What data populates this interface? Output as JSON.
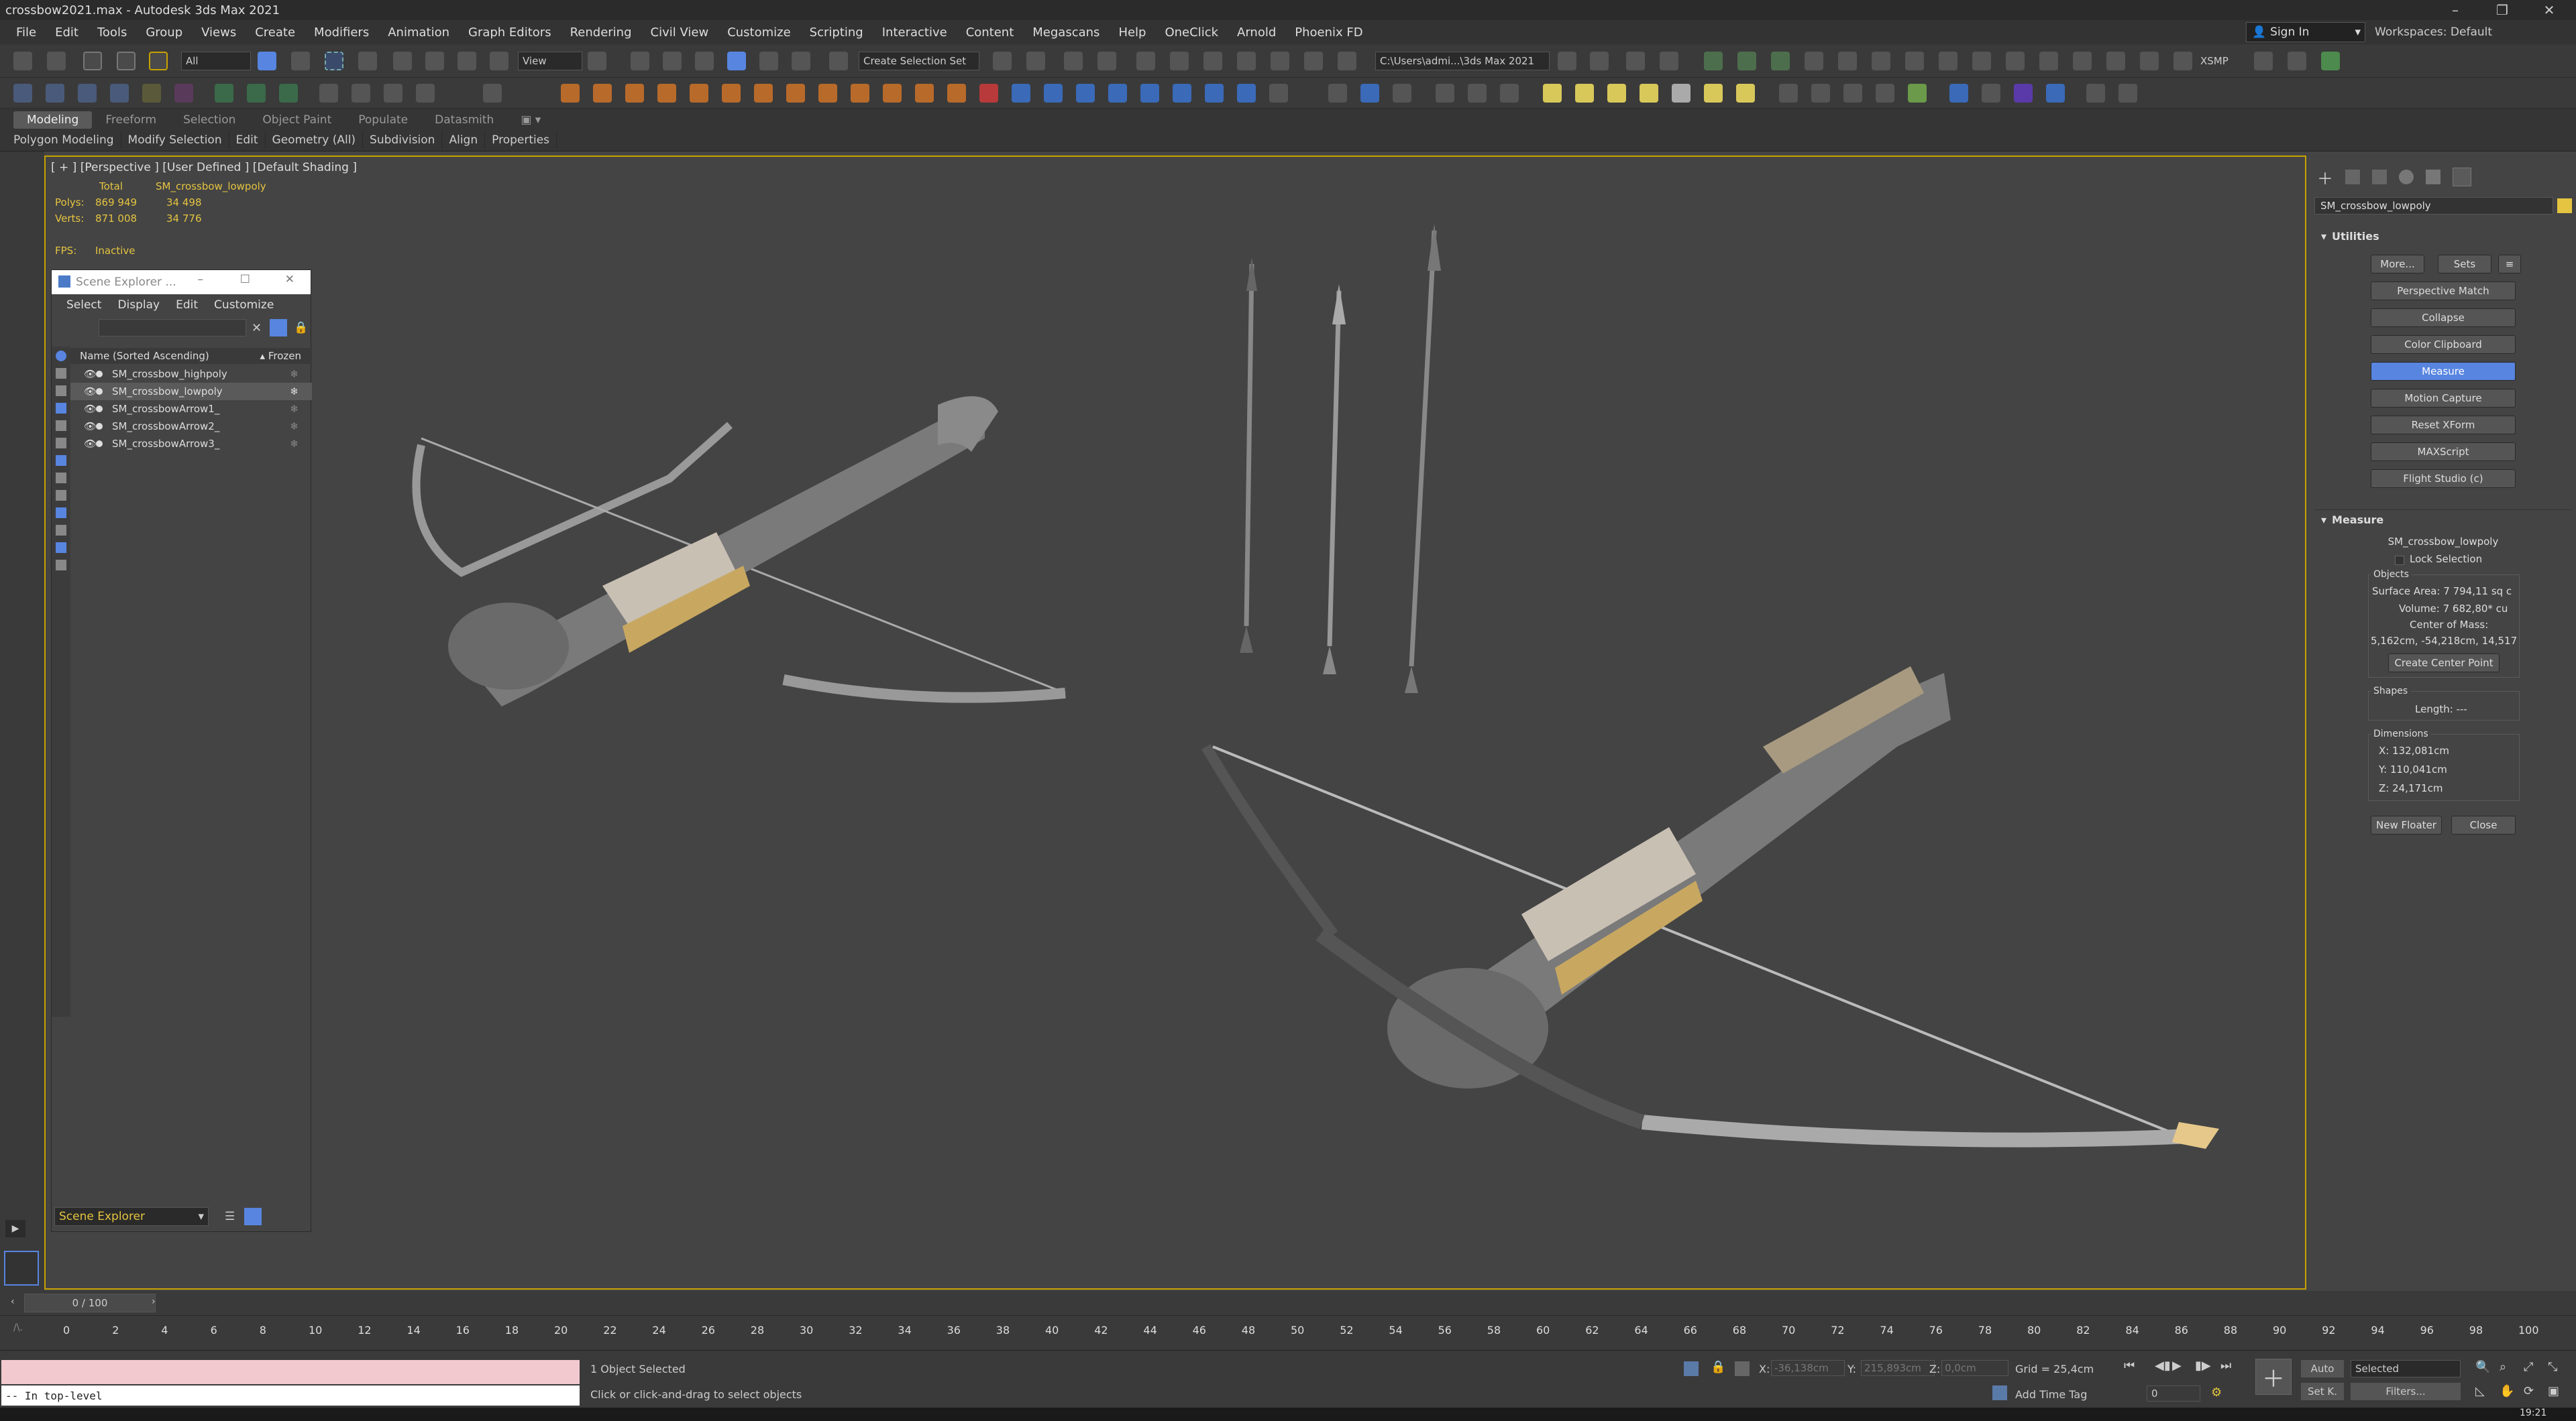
{
  "window": {
    "title": "crossbow2021.max - Autodesk 3ds Max 2021"
  },
  "menu": [
    "File",
    "Edit",
    "Tools",
    "Group",
    "Views",
    "Create",
    "Modifiers",
    "Animation",
    "Graph Editors",
    "Rendering",
    "Civil View",
    "Customize",
    "Scripting",
    "Interactive",
    "Content",
    "Megascans",
    "Help",
    "OneClick",
    "Arnold",
    "Phoenix FD"
  ],
  "account": {
    "sign_in": "Sign In",
    "workspaces_label": "Workspaces:",
    "workspace": "Default"
  },
  "toolbar": {
    "filter": "All",
    "ref_coord": "View",
    "selection_set": "Create Selection Set",
    "project_path": "C:\\Users\\admi...\\3ds Max 2021",
    "xsmp": "XSMP"
  },
  "ribbon": {
    "tabs": [
      "Modeling",
      "Freeform",
      "Selection",
      "Object Paint",
      "Populate",
      "Datasmith"
    ],
    "sub": [
      "Polygon Modeling",
      "Modify Selection",
      "Edit",
      "Geometry (All)",
      "Subdivision",
      "Align",
      "Properties"
    ]
  },
  "viewport": {
    "label": "[ + ] [Perspective ] [User Defined ] [Default Shading ]",
    "stats": {
      "total_label": "Total",
      "selected_name": "SM_crossbow_lowpoly",
      "polys_label": "Polys:",
      "polys_total": "869 949",
      "polys_sel": "34 498",
      "verts_label": "Verts:",
      "verts_total": "871 008",
      "verts_sel": "34 776",
      "fps_label": "FPS:",
      "fps_value": "Inactive"
    }
  },
  "scene_explorer": {
    "title": "Scene Explorer ...",
    "menu": [
      "Select",
      "Display",
      "Edit",
      "Customize"
    ],
    "col_name": "Name (Sorted Ascending)",
    "col_frozen": "▴ Frozen",
    "rows": [
      {
        "name": "SM_crossbow_highpoly",
        "active": false
      },
      {
        "name": "SM_crossbow_lowpoly",
        "active": true
      },
      {
        "name": "SM_crossbowArrow1_",
        "active": false
      },
      {
        "name": "SM_crossbowArrow2_",
        "active": false
      },
      {
        "name": "SM_crossbowArrow3_",
        "active": false
      }
    ],
    "footer": "Scene Explorer"
  },
  "command_panel": {
    "object_name": "SM_crossbow_lowpoly",
    "utilities": {
      "title": "Utilities",
      "more": "More...",
      "sets": "Sets",
      "buttons": [
        "Perspective Match",
        "Collapse",
        "Color Clipboard",
        "Measure",
        "Motion Capture",
        "Reset XForm",
        "MAXScript",
        "Flight Studio (c)"
      ],
      "active": "Measure"
    },
    "measure": {
      "title": "Measure",
      "object": "SM_crossbow_lowpoly",
      "lock_selection": "Lock Selection",
      "objects_label": "Objects",
      "surface_area": "Surface Area: 7 794,11 sq c",
      "volume": "Volume: 7 682,80* cu",
      "center_of_mass_label": "Center of Mass:",
      "center_of_mass": "5,162cm, -54,218cm, 14,517",
      "create_center_point": "Create Center Point",
      "shapes_label": "Shapes",
      "length": "Length: ---",
      "dimensions_label": "Dimensions",
      "dim_x": "X:  132,081cm",
      "dim_y": "Y:  110,041cm",
      "dim_z": "Z:  24,171cm",
      "new_floater": "New Floater",
      "close": "Close"
    }
  },
  "timeline": {
    "frame": "0 / 100",
    "ticks": [
      "0",
      "2",
      "4",
      "6",
      "8",
      "10",
      "12",
      "14",
      "16",
      "18",
      "20",
      "22",
      "24",
      "26",
      "28",
      "30",
      "32",
      "34",
      "36",
      "38",
      "40",
      "42",
      "44",
      "46",
      "48",
      "50",
      "52",
      "54",
      "56",
      "58",
      "60",
      "62",
      "64",
      "66",
      "68",
      "70",
      "72",
      "74",
      "76",
      "78",
      "80",
      "82",
      "84",
      "86",
      "88",
      "90",
      "92",
      "94",
      "96",
      "98",
      "100"
    ]
  },
  "status": {
    "maxscript_output": "-- In top-level",
    "selected": "1 Object Selected",
    "prompt": "Click or click-and-drag to select objects",
    "x_label": "X:",
    "x_val": "-36,138cm",
    "y_label": "Y:",
    "y_val": "215,893cm",
    "z_label": "Z:",
    "z_val": "0,0cm",
    "grid": "Grid = 25,4cm",
    "add_time_tag": "Add Time Tag",
    "auto": "Auto",
    "set_key": "Set K.",
    "key_filter": "Selected",
    "filters": "Filters...",
    "frame_field": "0",
    "clock": "19:21"
  },
  "colors": {
    "accent": "#5885e0",
    "viewport_border": "#c8a200",
    "stat_yellow": "#e4c440",
    "mxs_pink": "#f2c9cf"
  }
}
